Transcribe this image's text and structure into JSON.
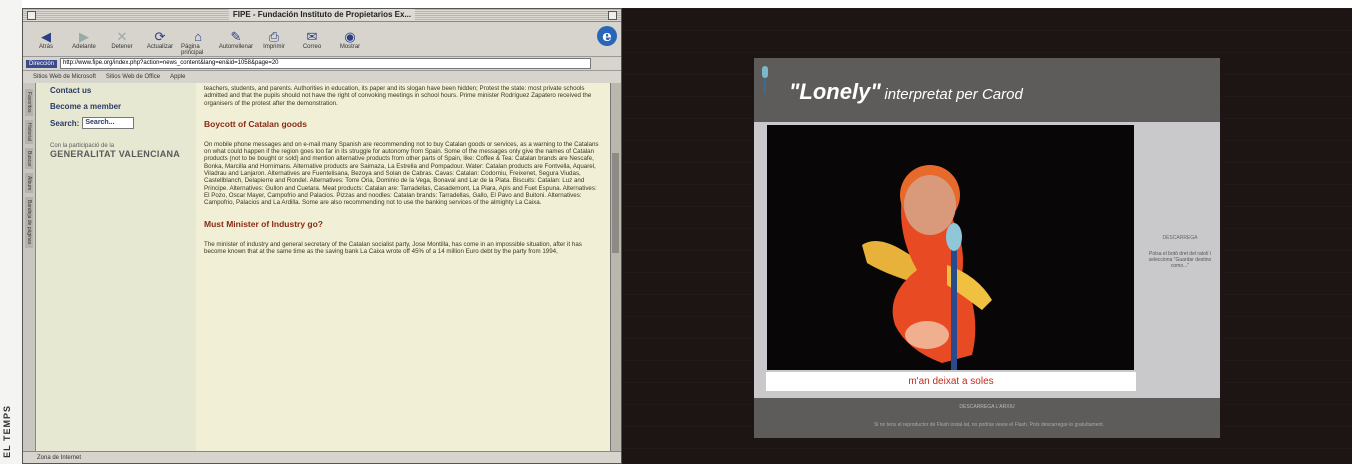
{
  "page_label": "EL TEMPS",
  "browser": {
    "title": "FIPE - Fundación Instituto de Propietarios Ex...",
    "toolbar": [
      {
        "label": "Atrás",
        "icon": "back-arrow-icon",
        "glyph": "◀",
        "enabled": true
      },
      {
        "label": "Adelante",
        "icon": "forward-arrow-icon",
        "glyph": "▶",
        "enabled": false
      },
      {
        "label": "Detener",
        "icon": "stop-icon",
        "glyph": "✕",
        "enabled": false
      },
      {
        "label": "Actualizar",
        "icon": "refresh-icon",
        "glyph": "⟳",
        "enabled": true
      },
      {
        "label": "Página principal",
        "icon": "home-icon",
        "glyph": "⌂",
        "enabled": true
      },
      {
        "label": "Autorrellenar",
        "icon": "autofill-icon",
        "glyph": "✎",
        "enabled": true
      },
      {
        "label": "Imprimir",
        "icon": "print-icon",
        "glyph": "⎙",
        "enabled": true
      },
      {
        "label": "Correo",
        "icon": "mail-icon",
        "glyph": "✉",
        "enabled": true
      },
      {
        "label": "Mostrar",
        "icon": "eye-icon",
        "glyph": "◉",
        "enabled": true
      }
    ],
    "address_label": "Dirección",
    "address": "http://www.fipe.org/index.php?action=news_content&lang=en&id=1058&page=20",
    "favorites": [
      "Sitios Web de Microsoft",
      "Sitios Web de Office",
      "Apple"
    ],
    "side_tabs": [
      "Favoritos",
      "Historial",
      "Buscar",
      "Álbum",
      "Bandeja de páginas"
    ],
    "status": "Zona de Internet"
  },
  "nav": {
    "contact": "Contact us",
    "member": "Become a member",
    "search_label": "Search:",
    "search_value": "Search...",
    "gv_small": "Con la participació de la",
    "gv_big": "GENERALITAT VALENCIANA"
  },
  "article": {
    "intro": "teachers, students, and parents. Authorities in education, its paper and its slogan have been hidden; Protest the state: most private schools admitted and that the pupils should not have the right of convoking meetings in school hours. Prime minister Rodríguez Zapatero received the organisers of the protest after the demonstration.",
    "h1": "Boycott of Catalan goods",
    "body1": "On mobile phone messages and on e-mail many Spanish are recommending not to buy Catalan goods or services, as a warning to the Catalans on what could happen if the region goes too far in its struggle for autonomy from Spain. Some of the messages only give the names of Catalan products (not to be bought or sold) and mention alternative products from other parts of Spain, like: Coffee & Tea: Catalan brands are Nescafe, Bonka, Marcilla and Hornimans. Alternative products are Saimaza, La Estrella and Pompadour. Water: Catalan products are Fontvella, Aquarel, Viladrau and Lanjaron. Alternatives are Fuentelisana, Bezoya and Solan de Cabras. Cavas: Catalan: Codorniu, Freixenet, Segura Viudas, Castellblanch, Delapierre and Rondel. Alternatives: Torre Oria, Dominio de la Vega, Bonaval and Lar de la Plata. Biscuits: Catalan: Luz and Principe. Alternatives: Gullon and Cuetara. Meat products: Catalan are: Tarradellas, Casademont, La Piara, Apis and Fuet Espuna. Alternatives: El Pozo, Oscar Mayer, Campofrio and Palacios. Pizzas and noodles: Catalan brands: Tarradellas, Gallo, El Pavo and Buitoni. Alternatives: Campofrio, Palacios and La Ardilla. Some are also recommending not to use the banking services of the almighty La Caixa.",
    "h2": "Must Minister of Industry go?",
    "body2": "The minister of industry and general secretary of the Catalan socialist party, Jose Montilla, has come in an impossible situation, after it has become known that at the same time as the saving bank La Caixa wrote off 45% of a 14 million Euro debt by the party from 1994,"
  },
  "player": {
    "title_quote": "\"Lonely\"",
    "title_rest": "interpretat per Carod",
    "caption": "m'an deixat a soles",
    "sidebar_title": "DESCARREGA",
    "sidebar_text": "Polsa el botó dret del ratolí i selecciona \"Guardar destino como...\"",
    "footer_link": "DESCARREGA L'ARXIU",
    "footer_text": "Si no tens el reproductor de Flash instal·lat, no podràs veure el Flash. Pots descarregar-lo gratuïtament."
  },
  "colors": {
    "article_bg": "#f1f0d7",
    "heading": "#8b2a12",
    "nav_link": "#2b3a66",
    "dark_bg": "#1d1414",
    "caption": "#c42a1c"
  }
}
